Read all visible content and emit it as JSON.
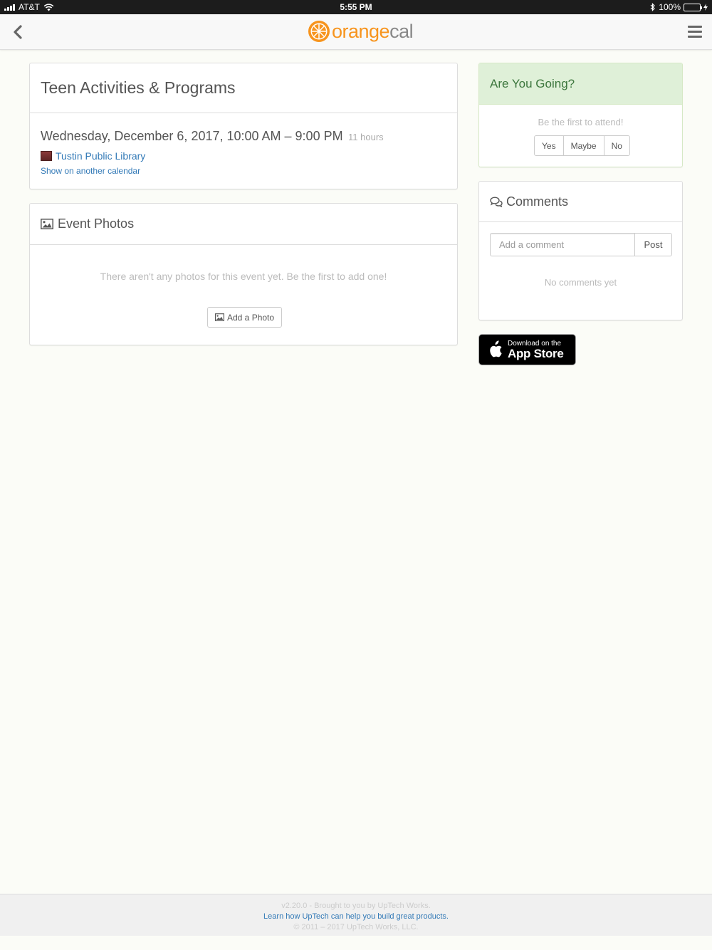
{
  "status_bar": {
    "carrier": "AT&T",
    "time": "5:55 PM",
    "battery": "100%"
  },
  "nav": {
    "logo_orange": "orange",
    "logo_cal": "cal"
  },
  "event": {
    "title": "Teen Activities & Programs",
    "date": "Wednesday, December 6, 2017, 10:00 AM – 9:00 PM",
    "duration": "11 hours",
    "location": "Tustin Public Library",
    "show_calendar": "Show on another calendar"
  },
  "photos": {
    "title": "Event Photos",
    "empty_text": "There aren't any photos for this event yet. Be the first to add one!",
    "add_label": "Add a Photo"
  },
  "rsvp": {
    "title": "Are You Going?",
    "subtitle": "Be the first to attend!",
    "options": [
      "Yes",
      "Maybe",
      "No"
    ]
  },
  "comments": {
    "title": "Comments",
    "placeholder": "Add a comment",
    "post_label": "Post",
    "empty_text": "No comments yet"
  },
  "app_store": {
    "line1": "Download on the",
    "line2": "App Store"
  },
  "footer": {
    "version": "v2.20.0 - Brought to you by UpTech Works.",
    "link": "Learn how UpTech can help you build great products.",
    "copyright": "© 2011 – 2017 UpTech Works, LLC."
  },
  "colors": {
    "accent_orange": "#f7941d",
    "link_blue": "#337ab7",
    "success_green": "#3c763d",
    "success_bg": "#dff0d8"
  }
}
